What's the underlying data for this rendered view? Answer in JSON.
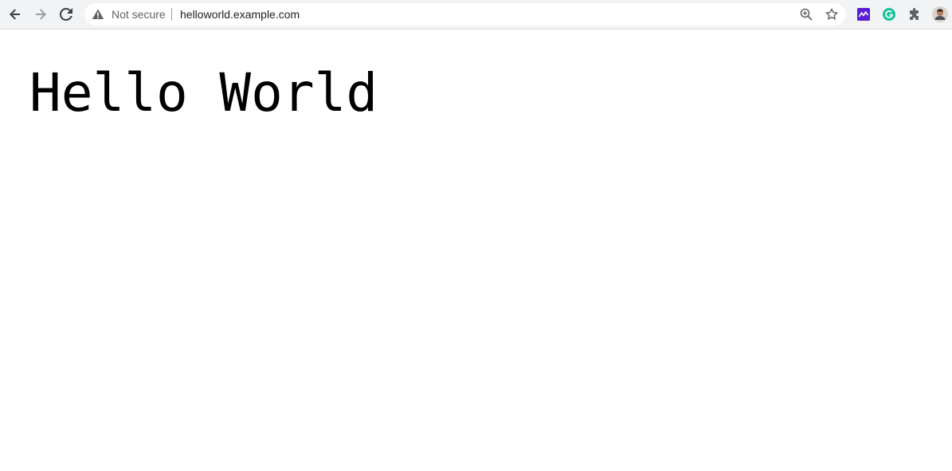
{
  "browser": {
    "nav": {
      "back_icon": "arrow-left-icon",
      "forward_icon": "arrow-right-icon",
      "reload_icon": "reload-icon"
    },
    "omnibox": {
      "security_icon": "warning-triangle-icon",
      "security_label": "Not secure",
      "url": "helloworld.example.com",
      "zoom_icon": "zoom-in-icon",
      "bookmark_icon": "star-icon"
    },
    "extensions": [
      {
        "name": "chart-extension-icon",
        "color": "#5b1cd6"
      },
      {
        "name": "grammarly-icon",
        "color": "#15c39a"
      },
      {
        "name": "puzzle-icon",
        "color": "#5f6368"
      }
    ],
    "profile_icon": "avatar"
  },
  "page": {
    "heading": "Hello World"
  },
  "colors": {
    "toolbar_bg": "#f1f3f4",
    "omnibox_bg": "#ffffff",
    "text_muted": "#5f6368",
    "text_main": "#202124"
  }
}
